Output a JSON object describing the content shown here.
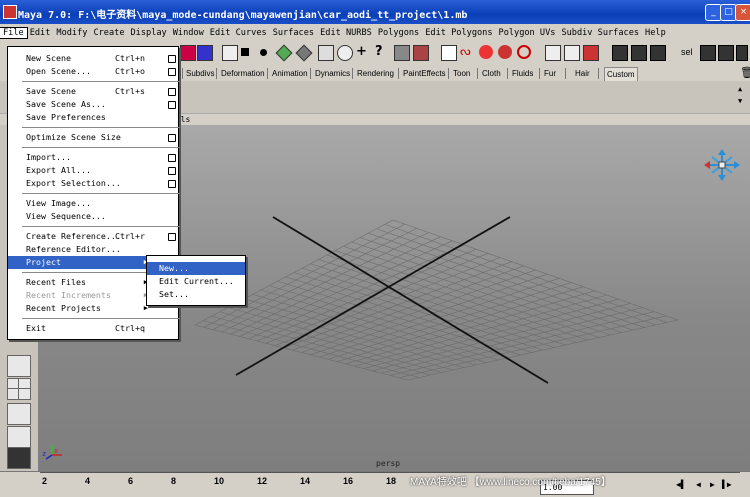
{
  "window": {
    "title": "Maya 7.0: F:\\电子资料\\maya_mode-cundang\\mayawenjian\\car_aodi_tt_project\\1.mb",
    "minimize": "_",
    "maximize": "□",
    "close": "×"
  },
  "menubar": [
    "File",
    "Edit",
    "Modify",
    "Create",
    "Display",
    "Window",
    "Edit Curves",
    "Surfaces",
    "Edit NURBS",
    "Polygons",
    "Edit Polygons",
    "Polygon UVs",
    "Subdiv Surfaces",
    "Help"
  ],
  "toolbar": {
    "sel_label": "sel"
  },
  "shelf_tabs": [
    "Subdivs",
    "Deformation",
    "Animation",
    "Dynamics",
    "Rendering",
    "PaintEffects",
    "Toon",
    "Cloth",
    "Fluids",
    "Fur",
    "Hair",
    "Custom"
  ],
  "panel_menu_fragment": "nels",
  "file_menu": {
    "items": [
      {
        "label": "New Scene",
        "shortcut": "Ctrl+n",
        "option": true
      },
      {
        "label": "Open Scene...",
        "shortcut": "Ctrl+o",
        "option": true
      },
      {
        "sep": true
      },
      {
        "label": "Save Scene",
        "shortcut": "Ctrl+s",
        "option": true
      },
      {
        "label": "Save Scene As...",
        "shortcut": "",
        "option": true
      },
      {
        "label": "Save Preferences",
        "shortcut": "",
        "option": false
      },
      {
        "sep": true
      },
      {
        "label": "Optimize Scene Size",
        "shortcut": "",
        "option": true
      },
      {
        "sep": true
      },
      {
        "label": "Import...",
        "shortcut": "",
        "option": true
      },
      {
        "label": "Export All...",
        "shortcut": "",
        "option": true
      },
      {
        "label": "Export Selection...",
        "shortcut": "",
        "option": true
      },
      {
        "sep": true
      },
      {
        "label": "View Image...",
        "shortcut": "",
        "option": false
      },
      {
        "label": "View Sequence...",
        "shortcut": "",
        "option": false
      },
      {
        "sep": true
      },
      {
        "label": "Create Reference...",
        "shortcut": "Ctrl+r",
        "option": true
      },
      {
        "label": "Reference Editor...",
        "shortcut": "",
        "option": false
      },
      {
        "label": "Project",
        "shortcut": "",
        "option": false,
        "submenu": true,
        "selected": true
      },
      {
        "sep": true
      },
      {
        "label": "Recent Files",
        "shortcut": "",
        "option": false,
        "submenu": true
      },
      {
        "label": "Recent Increments",
        "shortcut": "",
        "option": false,
        "submenu": true,
        "disabled": true
      },
      {
        "label": "Recent Projects",
        "shortcut": "",
        "option": false,
        "submenu": true
      },
      {
        "sep": true
      },
      {
        "label": "Exit",
        "shortcut": "Ctrl+q",
        "option": false
      }
    ]
  },
  "project_submenu": {
    "items": [
      {
        "label": "New...",
        "selected": true
      },
      {
        "label": "Edit Current..."
      },
      {
        "label": "Set..."
      }
    ]
  },
  "viewport": {
    "camera_label": "persp",
    "axis_x": "x",
    "axis_z": "z"
  },
  "timeslider": {
    "ticks": [
      "2",
      "4",
      "6",
      "8",
      "10",
      "12",
      "14",
      "16",
      "18"
    ],
    "current_frame": "1.00"
  },
  "watermark": "MAYA特效吧  【www.lineco.com/tieba/1745】",
  "colors": {
    "menu_highlight": "#3162c5",
    "titlebar": "#0a3fb8",
    "viewport": "#9a9a9a"
  }
}
